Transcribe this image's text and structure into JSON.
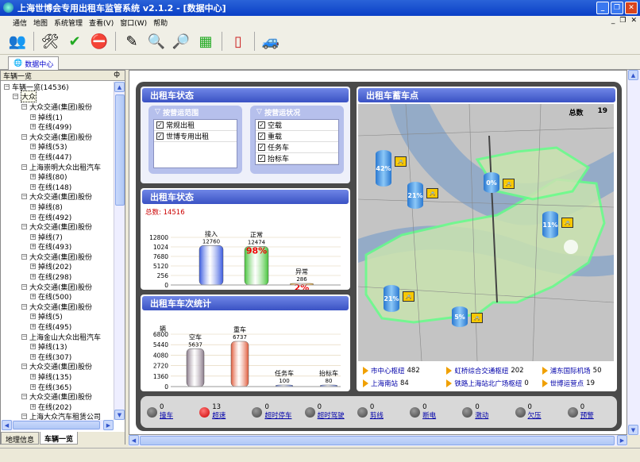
{
  "window": {
    "title": "上海世博会专用出租车监管系统 v2.1.2 - [数据中心]"
  },
  "menu": [
    "通信",
    "地图",
    "系统管理",
    "查看(V)",
    "窗口(W)",
    "帮助"
  ],
  "toolbar_icons": [
    "users-icon",
    "settings-icon",
    "check-icon",
    "cancel-icon",
    "edit-icon",
    "zoom-in-icon",
    "zoom-out-icon",
    "grid-icon",
    "report-icon",
    "car-icon"
  ],
  "doc_tab": "数据中心",
  "left": {
    "header": "车辆一览",
    "pin": "ф",
    "bottom_tabs": [
      "地理信息",
      "车辆一览"
    ],
    "tree": [
      {
        "d": 0,
        "t": "车辆一览(14536)",
        "pm": "-"
      },
      {
        "d": 1,
        "t": "大众",
        "pm": "-",
        "sel": true
      },
      {
        "d": 2,
        "t": "大众交通(集团)股份",
        "pm": "-"
      },
      {
        "d": 3,
        "t": "掉线(1)",
        "pm": "+"
      },
      {
        "d": 3,
        "t": "在线(499)",
        "pm": "+"
      },
      {
        "d": 2,
        "t": "大众交通(集团)股份",
        "pm": "-"
      },
      {
        "d": 3,
        "t": "掉线(53)",
        "pm": "+"
      },
      {
        "d": 3,
        "t": "在线(447)",
        "pm": "+"
      },
      {
        "d": 2,
        "t": "上海崇明大众出租汽车",
        "pm": "-"
      },
      {
        "d": 3,
        "t": "掉线(80)",
        "pm": "+"
      },
      {
        "d": 3,
        "t": "在线(148)",
        "pm": "+"
      },
      {
        "d": 2,
        "t": "大众交通(集团)股份",
        "pm": "-"
      },
      {
        "d": 3,
        "t": "掉线(8)",
        "pm": "+"
      },
      {
        "d": 3,
        "t": "在线(492)",
        "pm": "+"
      },
      {
        "d": 2,
        "t": "大众交通(集团)股份",
        "pm": "-"
      },
      {
        "d": 3,
        "t": "掉线(7)",
        "pm": "+"
      },
      {
        "d": 3,
        "t": "在线(493)",
        "pm": "+"
      },
      {
        "d": 2,
        "t": "大众交通(集团)股份",
        "pm": "-"
      },
      {
        "d": 3,
        "t": "掉线(202)",
        "pm": "+"
      },
      {
        "d": 3,
        "t": "在线(298)",
        "pm": "+"
      },
      {
        "d": 2,
        "t": "大众交通(集团)股份",
        "pm": "-"
      },
      {
        "d": 3,
        "t": "在线(500)",
        "pm": "+"
      },
      {
        "d": 2,
        "t": "大众交通(集团)股份",
        "pm": "-"
      },
      {
        "d": 3,
        "t": "掉线(5)",
        "pm": "+"
      },
      {
        "d": 3,
        "t": "在线(495)",
        "pm": "+"
      },
      {
        "d": 2,
        "t": "上海金山大众出租汽车",
        "pm": "-"
      },
      {
        "d": 3,
        "t": "掉线(13)",
        "pm": "+"
      },
      {
        "d": 3,
        "t": "在线(307)",
        "pm": "+"
      },
      {
        "d": 2,
        "t": "大众交通(集团)股份",
        "pm": "-"
      },
      {
        "d": 3,
        "t": "掉线(135)",
        "pm": "+"
      },
      {
        "d": 3,
        "t": "在线(365)",
        "pm": "+"
      },
      {
        "d": 2,
        "t": "大众交通(集团)股份",
        "pm": "-"
      },
      {
        "d": 3,
        "t": "在线(202)",
        "pm": "+"
      },
      {
        "d": 2,
        "t": "上海大众汽车租赁公司",
        "pm": "-"
      }
    ]
  },
  "status_panel": {
    "title": "出租车状态",
    "box1": {
      "title": "按营运范围",
      "items": [
        "常规出租",
        "世博专用出租"
      ]
    },
    "box2": {
      "title": "按营运状况",
      "items": [
        "空载",
        "重载",
        "任务车",
        "抬标车"
      ]
    }
  },
  "status_chart": {
    "title": "出租车状态",
    "total": "总数: 14516"
  },
  "trip_chart": {
    "title": "出租车车次统计",
    "unit": "辆"
  },
  "map_panel": {
    "title": "出租车蓄车点",
    "total_label": "总数",
    "total_value": "19",
    "legend": [
      {
        "name": "市中心枢纽",
        "value": "482"
      },
      {
        "name": "虹桥综合交通枢纽",
        "value": "202"
      },
      {
        "name": "浦东国际机场",
        "value": "50"
      },
      {
        "name": "上海南站",
        "value": "84"
      },
      {
        "name": "铁路上海站北广场枢纽",
        "value": "0"
      },
      {
        "name": "世博运营点",
        "value": "19"
      }
    ],
    "pct": [
      "42%",
      "21%",
      "0%",
      "11%",
      "21%",
      "5%"
    ]
  },
  "alarms": [
    {
      "count": "0",
      "label": "撞车",
      "red": false
    },
    {
      "count": "13",
      "label": "超速",
      "red": true
    },
    {
      "count": "0",
      "label": "超时停车",
      "red": false
    },
    {
      "count": "0",
      "label": "超时驾驶",
      "red": false
    },
    {
      "count": "0",
      "label": "剪线",
      "red": false
    },
    {
      "count": "0",
      "label": "断电",
      "red": false
    },
    {
      "count": "0",
      "label": "激动",
      "red": false
    },
    {
      "count": "0",
      "label": "欠压",
      "red": false
    },
    {
      "count": "0",
      "label": "预警",
      "red": false
    }
  ],
  "chart_data": [
    {
      "type": "bar",
      "title": "出租车状态",
      "categories": [
        "接入",
        "正常",
        "异常"
      ],
      "values": [
        12760,
        12474,
        286
      ],
      "percent_labels": [
        "",
        "98%",
        "2%"
      ],
      "yticks": [
        "12800",
        "1024",
        "7680",
        "5120",
        "256",
        "0"
      ],
      "colors": [
        "#3a5ae0",
        "#46c43a",
        "#f0a010"
      ]
    },
    {
      "type": "bar",
      "title": "出租车车次统计",
      "ylabel": "辆",
      "categories": [
        "空车",
        "重车",
        "任务车",
        "抬标车"
      ],
      "values": [
        5637,
        6737,
        100,
        80
      ],
      "yticks": [
        "6800",
        "5440",
        "4080",
        "2720",
        "1360",
        "0"
      ],
      "colors": [
        "#8a7a8a",
        "#e05a3a",
        "#4a6ae0",
        "#4a6ae0"
      ]
    }
  ]
}
